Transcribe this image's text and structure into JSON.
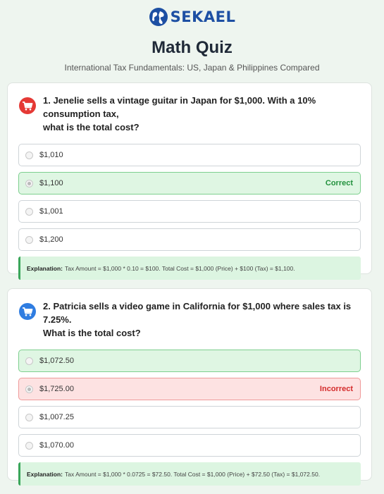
{
  "brand": {
    "name": "SEKAEL",
    "color": "#1d4fa3"
  },
  "quiz": {
    "title": "Math Quiz",
    "subtitle": "International Tax Fundamentals: US, Japan & Philippines Compared"
  },
  "colors": {
    "correct": "#22913d",
    "incorrect": "#d42a2a",
    "correct_bg": "#dff6e3",
    "incorrect_bg": "#fde2e2"
  },
  "questions": [
    {
      "icon": "cart-icon-red",
      "text_line1": "1. Jenelie sells a vintage guitar in Japan for $1,000. With a 10% consumption tax,",
      "text_line2": "what is the total cost?",
      "options": [
        {
          "label": "$1,010",
          "state": "neutral",
          "status": ""
        },
        {
          "label": "$1,100",
          "state": "correct",
          "status": "Correct"
        },
        {
          "label": "$1,001",
          "state": "neutral",
          "status": ""
        },
        {
          "label": "$1,200",
          "state": "neutral",
          "status": ""
        }
      ],
      "explanation_label": "Explanation:",
      "explanation_text": "Tax Amount = $1,000 * 0.10 = $100. Total Cost = $1,000 (Price) + $100 (Tax) = $1,100."
    },
    {
      "icon": "cart-icon-blue",
      "text_line1": "2. Patricia sells a video game in California for $1,000 where sales tax is 7.25%.",
      "text_line2": "What is the total cost?",
      "options": [
        {
          "label": "$1,072.50",
          "state": "correct",
          "status": ""
        },
        {
          "label": "$1,725.00",
          "state": "incorrect",
          "status": "Incorrect"
        },
        {
          "label": "$1,007.25",
          "state": "neutral",
          "status": ""
        },
        {
          "label": "$1,070.00",
          "state": "neutral",
          "status": ""
        }
      ],
      "explanation_label": "Explanation:",
      "explanation_text": "Tax Amount = $1,000 * 0.0725 = $72.50. Total Cost = $1,000 (Price) + $72.50 (Tax) = $1,072.50."
    }
  ]
}
